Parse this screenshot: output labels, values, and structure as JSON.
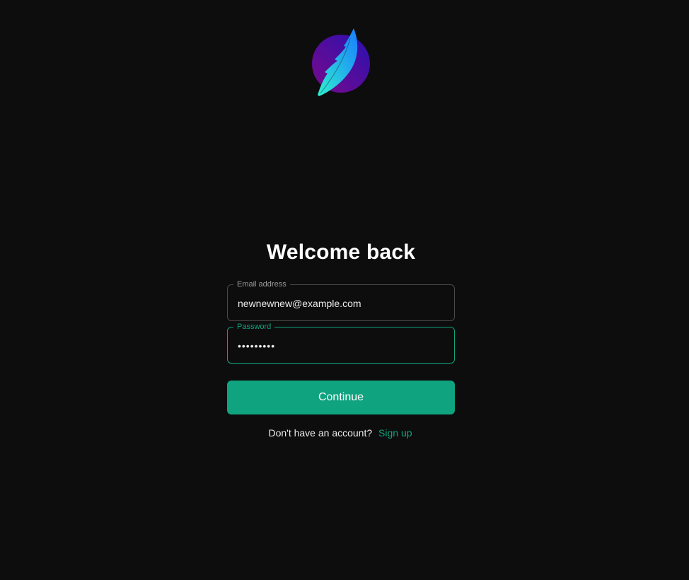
{
  "brand": {
    "logo_icon": "feather-logo-icon",
    "colors": {
      "circle_start": "#7a0a8a",
      "circle_end": "#2a10b0",
      "feather_start": "#2ef0d0",
      "feather_end": "#1a7cff"
    }
  },
  "login": {
    "title": "Welcome back",
    "email": {
      "label": "Email address",
      "value": "newnewnew@example.com"
    },
    "password": {
      "label": "Password",
      "value": "•••••••••"
    },
    "continue_label": "Continue",
    "signup_prompt": "Don't have an account?",
    "signup_link": "Sign up"
  },
  "theme": {
    "background": "#0d0d0d",
    "accent": "#10a37f",
    "border": "#4a4a4a"
  }
}
